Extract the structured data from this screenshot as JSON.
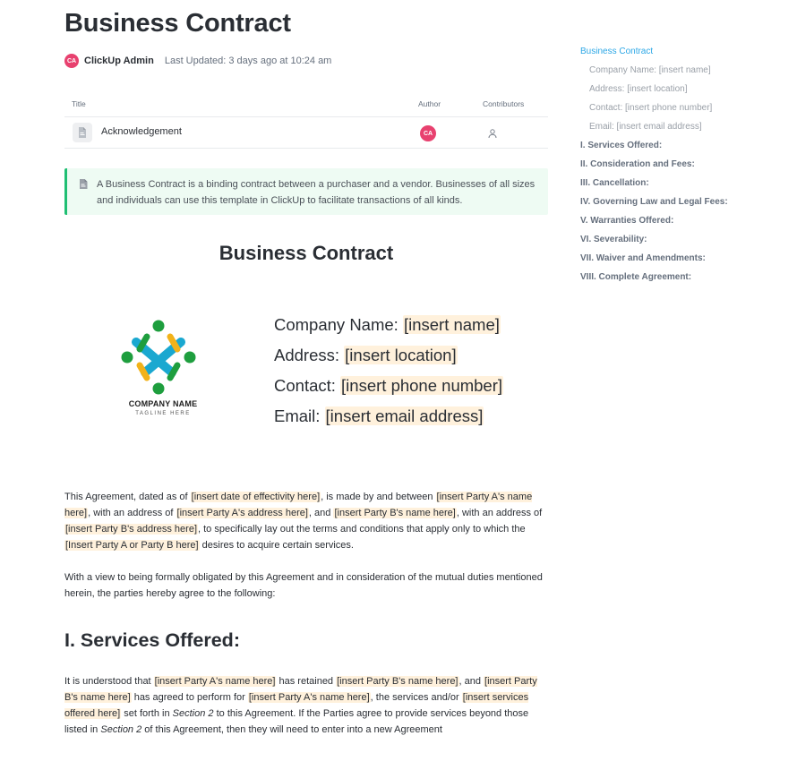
{
  "page": {
    "title": "Business Contract",
    "author_initials": "CA",
    "author_name": "ClickUp Admin",
    "last_updated": "Last Updated: 3 days ago at 10:24 am"
  },
  "relationship_table": {
    "headers": {
      "title": "Title",
      "author": "Author",
      "contributors": "Contributors"
    },
    "rows": [
      {
        "title": "Acknowledgement",
        "author_initials": "CA"
      }
    ]
  },
  "callout": {
    "text": "A Business Contract is a binding contract between a purchaser and a vendor. Businesses of all sizes and individuals can use this template in ClickUp to facilitate transactions of all kinds."
  },
  "document": {
    "heading": "Business Contract",
    "logo": {
      "name": "COMPANY NAME",
      "tagline": "TAGLINE HERE"
    },
    "company_fields": [
      {
        "label": "Company Name:",
        "value": "[insert name]"
      },
      {
        "label": "Address:",
        "value": "[insert location]"
      },
      {
        "label": "Contact:",
        "value": "[insert phone number]"
      },
      {
        "label": "Email:",
        "value": "[insert email address]"
      }
    ],
    "p1": {
      "t1": "This Agreement, dated as of ",
      "h1": "[insert date of effectivity here]",
      "t2": ", is made by and between ",
      "h2": "[insert Party A's name here]",
      "t3": ", with an address of ",
      "h3": "[insert Party A's address here]",
      "t4": ", and ",
      "h4": "[insert Party B's name here]",
      "t5": ", with an address of ",
      "h5": "[insert Party B's address here]",
      "t6": ", to specifically lay out the terms and conditions that apply only to which the ",
      "h6": "[Insert Party A or Party B here]",
      "t7": " desires to acquire certain services."
    },
    "p2": "With a view to being formally obligated by this Agreement and in consideration of the mutual duties mentioned herein, the parties hereby agree to the following:",
    "section1_heading": "I. Services Offered:",
    "p3": {
      "t1": "It is understood that ",
      "h1": "[insert Party A's name here]",
      "t2": " has retained ",
      "h2": "[insert Party B's name here]",
      "t3": ", and ",
      "h3": "[insert Party B's name here]",
      "t4": " has agreed to perform for ",
      "h4": "[insert Party A's name here]",
      "t5": ", the services and/or ",
      "h5": "[insert services offered here]",
      "t6": " set forth in ",
      "e1": "Section 2",
      "t7": " to this Agreement. If the Parties agree to provide services beyond those listed in ",
      "e2": "Section 2",
      "t8": " of this Agreement, then they will need to enter into a new Agreement"
    }
  },
  "toc": {
    "items": [
      {
        "label": "Business Contract",
        "level": "active"
      },
      {
        "label": "Company Name: [insert name]",
        "level": "sub"
      },
      {
        "label": "Address: [insert location]",
        "level": "sub"
      },
      {
        "label": "Contact: [insert phone number]",
        "level": "sub"
      },
      {
        "label": "Email: [insert email address]",
        "level": "sub"
      },
      {
        "label": "I. Services Offered:",
        "level": "main"
      },
      {
        "label": "II. Consideration and Fees:",
        "level": "main"
      },
      {
        "label": "III. Cancellation:",
        "level": "main"
      },
      {
        "label": "IV. Governing Law and Legal Fees:",
        "level": "main"
      },
      {
        "label": "V. Warranties Offered:",
        "level": "main"
      },
      {
        "label": "VI. Severability:",
        "level": "main"
      },
      {
        "label": "VII. Waiver and Amendments:",
        "level": "main"
      },
      {
        "label": "VIII. Complete Agreement:",
        "level": "main"
      }
    ]
  },
  "colors": {
    "accent": "#2ca7e6",
    "avatar": "#e8416f",
    "callout_border": "#1fbf73",
    "callout_bg": "#eefbf3",
    "placeholder_highlight": "#fff1dc"
  }
}
